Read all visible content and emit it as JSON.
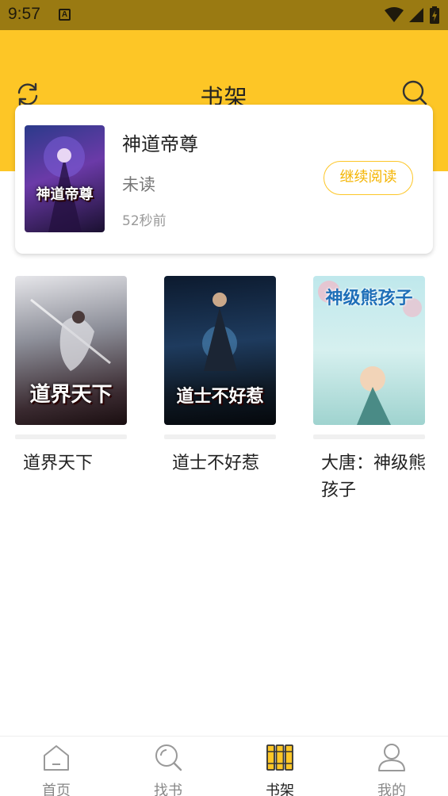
{
  "status_bar": {
    "time": "9:57",
    "sim_label": "A"
  },
  "header": {
    "title": "书架"
  },
  "featured": {
    "title": "神道帝尊",
    "status": "未读",
    "last_read": "52秒前",
    "continue_label": "继续阅读",
    "cover_text": "神道帝尊"
  },
  "books": [
    {
      "title": "道界天下",
      "cover_text": "道界天下"
    },
    {
      "title": "道士不好惹",
      "cover_text": "道士不好惹"
    },
    {
      "title": "大唐：神级熊孩子",
      "cover_text": "神级熊孩子"
    }
  ],
  "nav": [
    {
      "label": "首页",
      "icon": "home-icon",
      "active": false
    },
    {
      "label": "找书",
      "icon": "search-icon",
      "active": false
    },
    {
      "label": "书架",
      "icon": "bookshelf-icon",
      "active": true
    },
    {
      "label": "我的",
      "icon": "profile-icon",
      "active": false
    }
  ],
  "colors": {
    "accent": "#fdc626",
    "status_bar": "#9a7a12"
  }
}
